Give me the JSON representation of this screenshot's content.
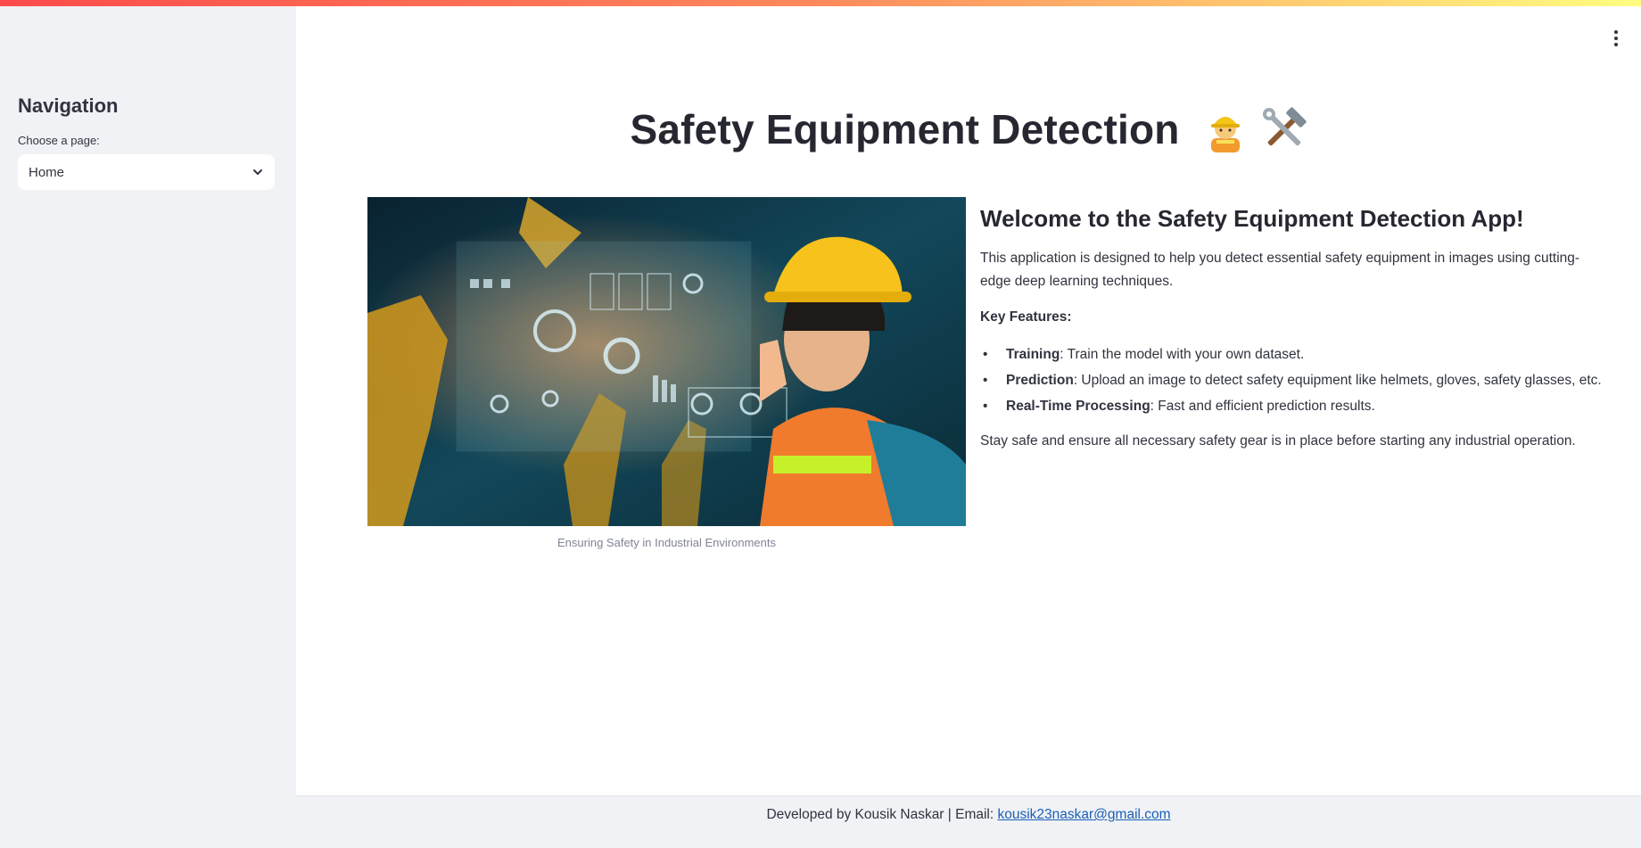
{
  "sidebar": {
    "heading": "Navigation",
    "select_label": "Choose a page:",
    "selected_page": "Home"
  },
  "main": {
    "title": "Safety Equipment Detection",
    "title_emojis": [
      "👷",
      "🛠️"
    ],
    "image_caption": "Ensuring Safety in Industrial Environments",
    "welcome_heading": "Welcome to the Safety Equipment Detection App!",
    "intro": "This application is designed to help you detect essential safety equipment in images using cutting-edge deep learning techniques.",
    "key_features_label": "Key Features:",
    "features": [
      {
        "name": "Training",
        "desc": ": Train the model with your own dataset."
      },
      {
        "name": "Prediction",
        "desc": ": Upload an image to detect safety equipment like helmets, gloves, safety glasses, etc."
      },
      {
        "name": "Real-Time Processing",
        "desc": ": Fast and efficient prediction results."
      }
    ],
    "closing": "Stay safe and ensure all necessary safety gear is in place before starting any industrial operation."
  },
  "footer": {
    "prefix": "Developed by Kousik Naskar | Email: ",
    "email": "kousik23naskar@gmail.com"
  },
  "colors": {
    "sidebar_bg": "#f0f2f6",
    "text": "#31333f",
    "link": "#1a5fb4",
    "top_gradient": [
      "#ff4b4b",
      "#fffd80"
    ]
  }
}
